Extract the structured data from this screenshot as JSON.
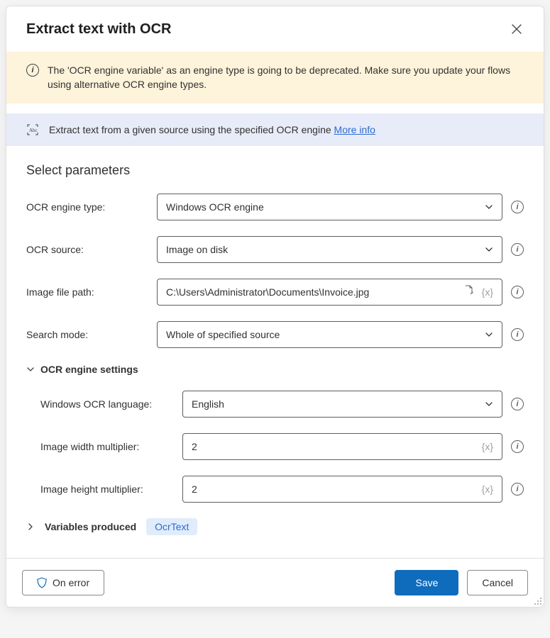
{
  "dialog": {
    "title": "Extract text with OCR"
  },
  "warning": {
    "message": "The 'OCR engine variable' as an engine type is going to be deprecated.  Make sure you update your flows using alternative OCR engine types."
  },
  "info": {
    "description": "Extract text from a given source using the specified OCR engine ",
    "link_label": "More info"
  },
  "section": {
    "title": "Select parameters"
  },
  "fields": {
    "engine_type": {
      "label": "OCR engine type:",
      "value": "Windows OCR engine"
    },
    "ocr_source": {
      "label": "OCR source:",
      "value": "Image on disk"
    },
    "file_path": {
      "label": "Image file path:",
      "value": "C:\\Users\\Administrator\\Documents\\Invoice.jpg"
    },
    "search_mode": {
      "label": "Search mode:",
      "value": "Whole of specified source"
    }
  },
  "engine_settings": {
    "title": "OCR engine settings",
    "language": {
      "label": "Windows OCR language:",
      "value": "English"
    },
    "width": {
      "label": "Image width multiplier:",
      "value": "2"
    },
    "height": {
      "label": "Image height multiplier:",
      "value": "2"
    }
  },
  "variables": {
    "title": "Variables produced",
    "pill": "OcrText"
  },
  "footer": {
    "on_error": "On error",
    "save": "Save",
    "cancel": "Cancel"
  }
}
